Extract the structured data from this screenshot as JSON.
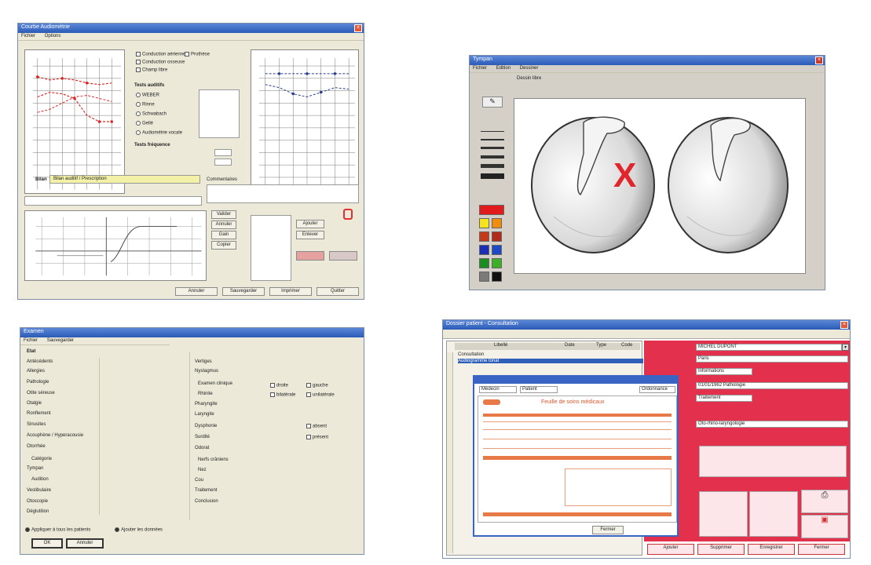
{
  "panel_audiogram": {
    "title": "Courbe Audiométrie",
    "menu": [
      "Fichier",
      "Options"
    ],
    "legend_items": [
      "Conduction aérienne",
      "Conduction osseuse",
      "Champ libre",
      "Prothèse"
    ],
    "section_test": "Tests auditifs",
    "radio_items": [
      "WEBER",
      "Rinne",
      "Schwabach",
      "Gellé",
      "Audiométrie vocale"
    ],
    "section_freq": "Tests fréquence",
    "remarks_label": "Commentaires",
    "tab_label": "Bilan",
    "tab_title": "Bilan auditif / Prescription",
    "buttons": [
      "Effacer",
      "Légende",
      "Imprimer",
      "Fermer"
    ],
    "side_buttons": [
      "Valider",
      "Annuler",
      "Gain",
      "Copier"
    ],
    "right_buttons": [
      "Ajouter",
      "Enlever"
    ],
    "bottom_buttons": [
      "Annuler",
      "Sauvegarder",
      "Imprimer",
      "Quitter"
    ]
  },
  "panel_tympan": {
    "title": "Tympan",
    "menu": [
      "Fichier",
      "Edition",
      "Dessiner"
    ],
    "toolbar_label": "Dessin libre",
    "mark": "X",
    "colors": [
      "#e11b1b",
      "#f28c0c",
      "#f5e31b",
      "#c43b1a",
      "#1a2db3",
      "#1d49c4",
      "#1a8c22",
      "#3cb025",
      "#7a7a7a",
      "#111111"
    ]
  },
  "panel_examen": {
    "title": "Examen",
    "menu": [
      "Fichier",
      "Sauvegarder"
    ],
    "section": "Etat",
    "left_items": [
      "Antécédents",
      "Allergies",
      "Pathologie",
      "Otite séreuse",
      "Otalgie",
      "Ronflement",
      "Sinusites",
      "Acouphène / Hyperacousie",
      "Otorrhée",
      "Catégorie",
      "Tympan",
      "Audition",
      "Vestibulaire",
      "Otoscopie",
      "Déglutition"
    ],
    "right_items": [
      "Vertiges",
      "Nystagmus",
      "Examen clinique",
      "Rhinite",
      "Pharyngite",
      "Laryngite",
      "Dysphonie",
      "Surdité",
      "Odorat",
      "Nerfs crâniens",
      "Nez",
      "Cou",
      "Traitement",
      "Conclusion"
    ],
    "checks_right": [
      "droite",
      "gauche",
      "bilatérale",
      "unilatérale",
      "absent",
      "présent"
    ],
    "radio_bottom": [
      "Appliquer à tous les patients",
      "Ajouter les données"
    ],
    "ok": "OK",
    "cancel": "Annuler"
  },
  "panel_dossier": {
    "title": "Dossier patient - Consultation",
    "list_headers": [
      "Libellé",
      "Date",
      "Type",
      "Code"
    ],
    "list_rows": [
      "Consultation",
      "Audiogramme tonal"
    ],
    "inner_title": "Feuille de soins médicaux",
    "inner_subtitle": "Feuille de soins médicaux",
    "inner_combo1": "Médecin",
    "inner_combo2": "Patient",
    "inner_combo3": "Ordonnance",
    "fields": [
      "MICHEL DUPONT",
      "Paris",
      "Informations",
      "01/01/1962 Pathologie",
      "Traitement",
      "Oto-rhino-laryngologie"
    ],
    "bottom_buttons": [
      "Ajouter",
      "Supprimer",
      "Enregistrer",
      "Fermer"
    ],
    "close_btn": "Fermer"
  }
}
